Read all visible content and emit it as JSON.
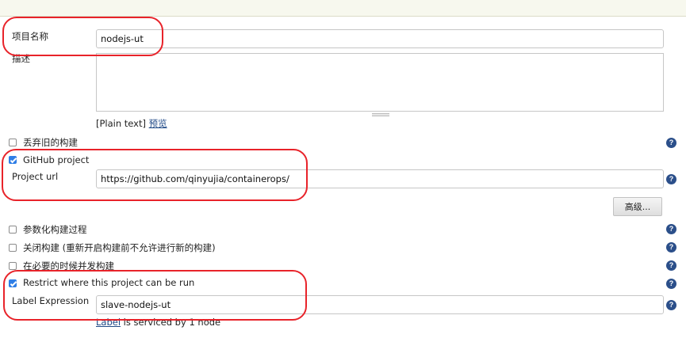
{
  "fields": {
    "project_name": {
      "label": "项目名称",
      "value": "nodejs-ut"
    },
    "description": {
      "label": "描述",
      "value": ""
    },
    "format_prefix": "[Plain text]",
    "preview_link": "预览"
  },
  "options": {
    "discard_builds": {
      "label": "丢弃旧的构建",
      "checked": false
    },
    "github_project": {
      "label": "GitHub project",
      "checked": true
    },
    "project_url": {
      "label": "Project url",
      "value": "https://github.com/qinyujia/containerops/"
    },
    "advanced_button": "高级...",
    "parameterized": {
      "label": "参数化构建过程",
      "checked": false
    },
    "disable_build": {
      "label": "关闭构建 (重新开启构建前不允许进行新的构建)",
      "checked": false
    },
    "concurrent_build": {
      "label": "在必要的时候并发构建",
      "checked": false
    },
    "restrict": {
      "label": "Restrict where this project can be run",
      "checked": true
    },
    "label_expression": {
      "label": "Label Expression",
      "value": "slave-nodejs-ut"
    },
    "label_note_link": "Label",
    "label_note_text": " is serviced by 1 node"
  },
  "help_symbol": "?",
  "colors": {
    "annotation": "#e8232a",
    "checkbox_checked": "#2f7ee6",
    "help_icon": "#2b4f8a",
    "link": "#204a87"
  }
}
